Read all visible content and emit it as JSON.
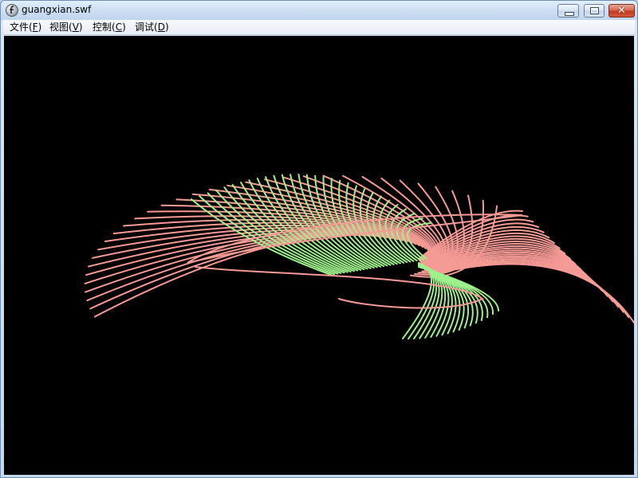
{
  "window": {
    "title": "guangxian.swf",
    "icon": "flash-player-icon",
    "close_glyph": "✕"
  },
  "menu": {
    "items": [
      {
        "label": "文件(",
        "hotkey": "F",
        "suffix": ")"
      },
      {
        "label": "视图(",
        "hotkey": "V",
        "suffix": ")"
      },
      {
        "label": "控制(",
        "hotkey": "C",
        "suffix": ")"
      },
      {
        "label": "调试(",
        "hotkey": "D",
        "suffix": ")"
      }
    ]
  },
  "stage": {
    "background": "#000000",
    "colors": {
      "pink": "#f59a94",
      "green": "#9ef08c"
    }
  }
}
